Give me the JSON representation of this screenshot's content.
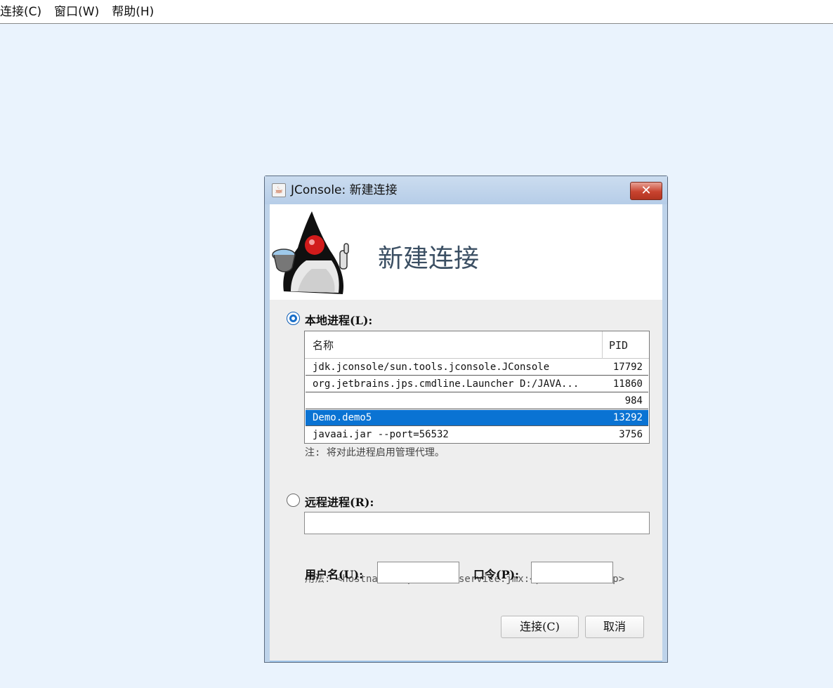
{
  "menubar": {
    "items": [
      {
        "label": "连接(C)"
      },
      {
        "label": "窗口(W)"
      },
      {
        "label": "帮助(H)"
      }
    ]
  },
  "dialog": {
    "title": "JConsole: 新建连接",
    "close_label": "✕",
    "banner_title": "新建连接",
    "local": {
      "label": "本地进程(L):",
      "selected": true,
      "columns": {
        "name": "名称",
        "pid": "PID"
      },
      "rows": [
        {
          "name": "jdk.jconsole/sun.tools.jconsole.JConsole",
          "pid": "17792"
        },
        {
          "name": "org.jetbrains.jps.cmdline.Launcher D:/JAVA...",
          "pid": "11860"
        },
        {
          "name": "",
          "pid": "984"
        },
        {
          "name": "Demo.demo5",
          "pid": "13292",
          "selected": true
        },
        {
          "name": "javaai.jar --port=56532",
          "pid": "3756"
        }
      ],
      "note": "注: 将对此进程启用管理代理。"
    },
    "remote": {
      "label": "远程进程(R):",
      "selected": false,
      "url_value": "",
      "usage": "用法: <hostname>:<port> 或 service:jmx:<protocol>:<sap>",
      "username_label": "用户名(U):",
      "username_value": "",
      "password_label": "口令(P):",
      "password_value": ""
    },
    "buttons": {
      "connect": "连接(C)",
      "cancel": "取消"
    }
  },
  "colors": {
    "desktop": "#eaf3fd",
    "selection": "#0a73d3",
    "radio_accent": "#1a6fc9",
    "close_button": "#c8432f"
  }
}
